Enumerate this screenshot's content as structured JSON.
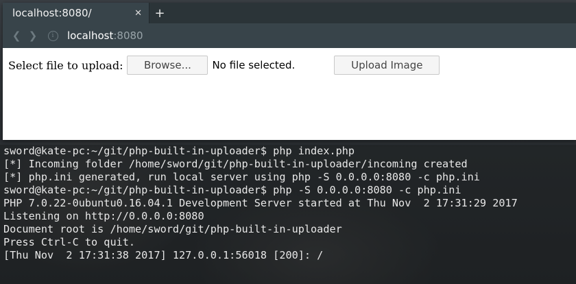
{
  "browser": {
    "tab": {
      "title": "localhost:8080/",
      "close_icon": "close-icon"
    },
    "new_tab_label": "+",
    "nav": {
      "back_icon": "chevron-left-icon",
      "forward_icon": "chevron-right-icon",
      "info_icon": "info-icon",
      "url_host": "localhost",
      "url_port": ":8080"
    }
  },
  "form": {
    "label": "Select file to upload:",
    "browse_label": "Browse...",
    "file_status": "No file selected.",
    "upload_label": "Upload Image"
  },
  "terminal": {
    "lines": [
      "sword@kate-pc:~/git/php-built-in-uploader$ php index.php",
      "[*] Incoming folder /home/sword/git/php-built-in-uploader/incoming created",
      "[*] php.ini generated, run local server using php -S 0.0.0.0:8080 -c php.ini",
      "sword@kate-pc:~/git/php-built-in-uploader$ php -S 0.0.0.0:8080 -c php.ini",
      "PHP 7.0.22-0ubuntu0.16.04.1 Development Server started at Thu Nov  2 17:31:29 2017",
      "Listening on http://0.0.0.0:8080",
      "Document root is /home/sword/git/php-built-in-uploader",
      "Press Ctrl-C to quit.",
      "[Thu Nov  2 17:31:38 2017] 127.0.0.1:56018 [200]: /"
    ]
  }
}
